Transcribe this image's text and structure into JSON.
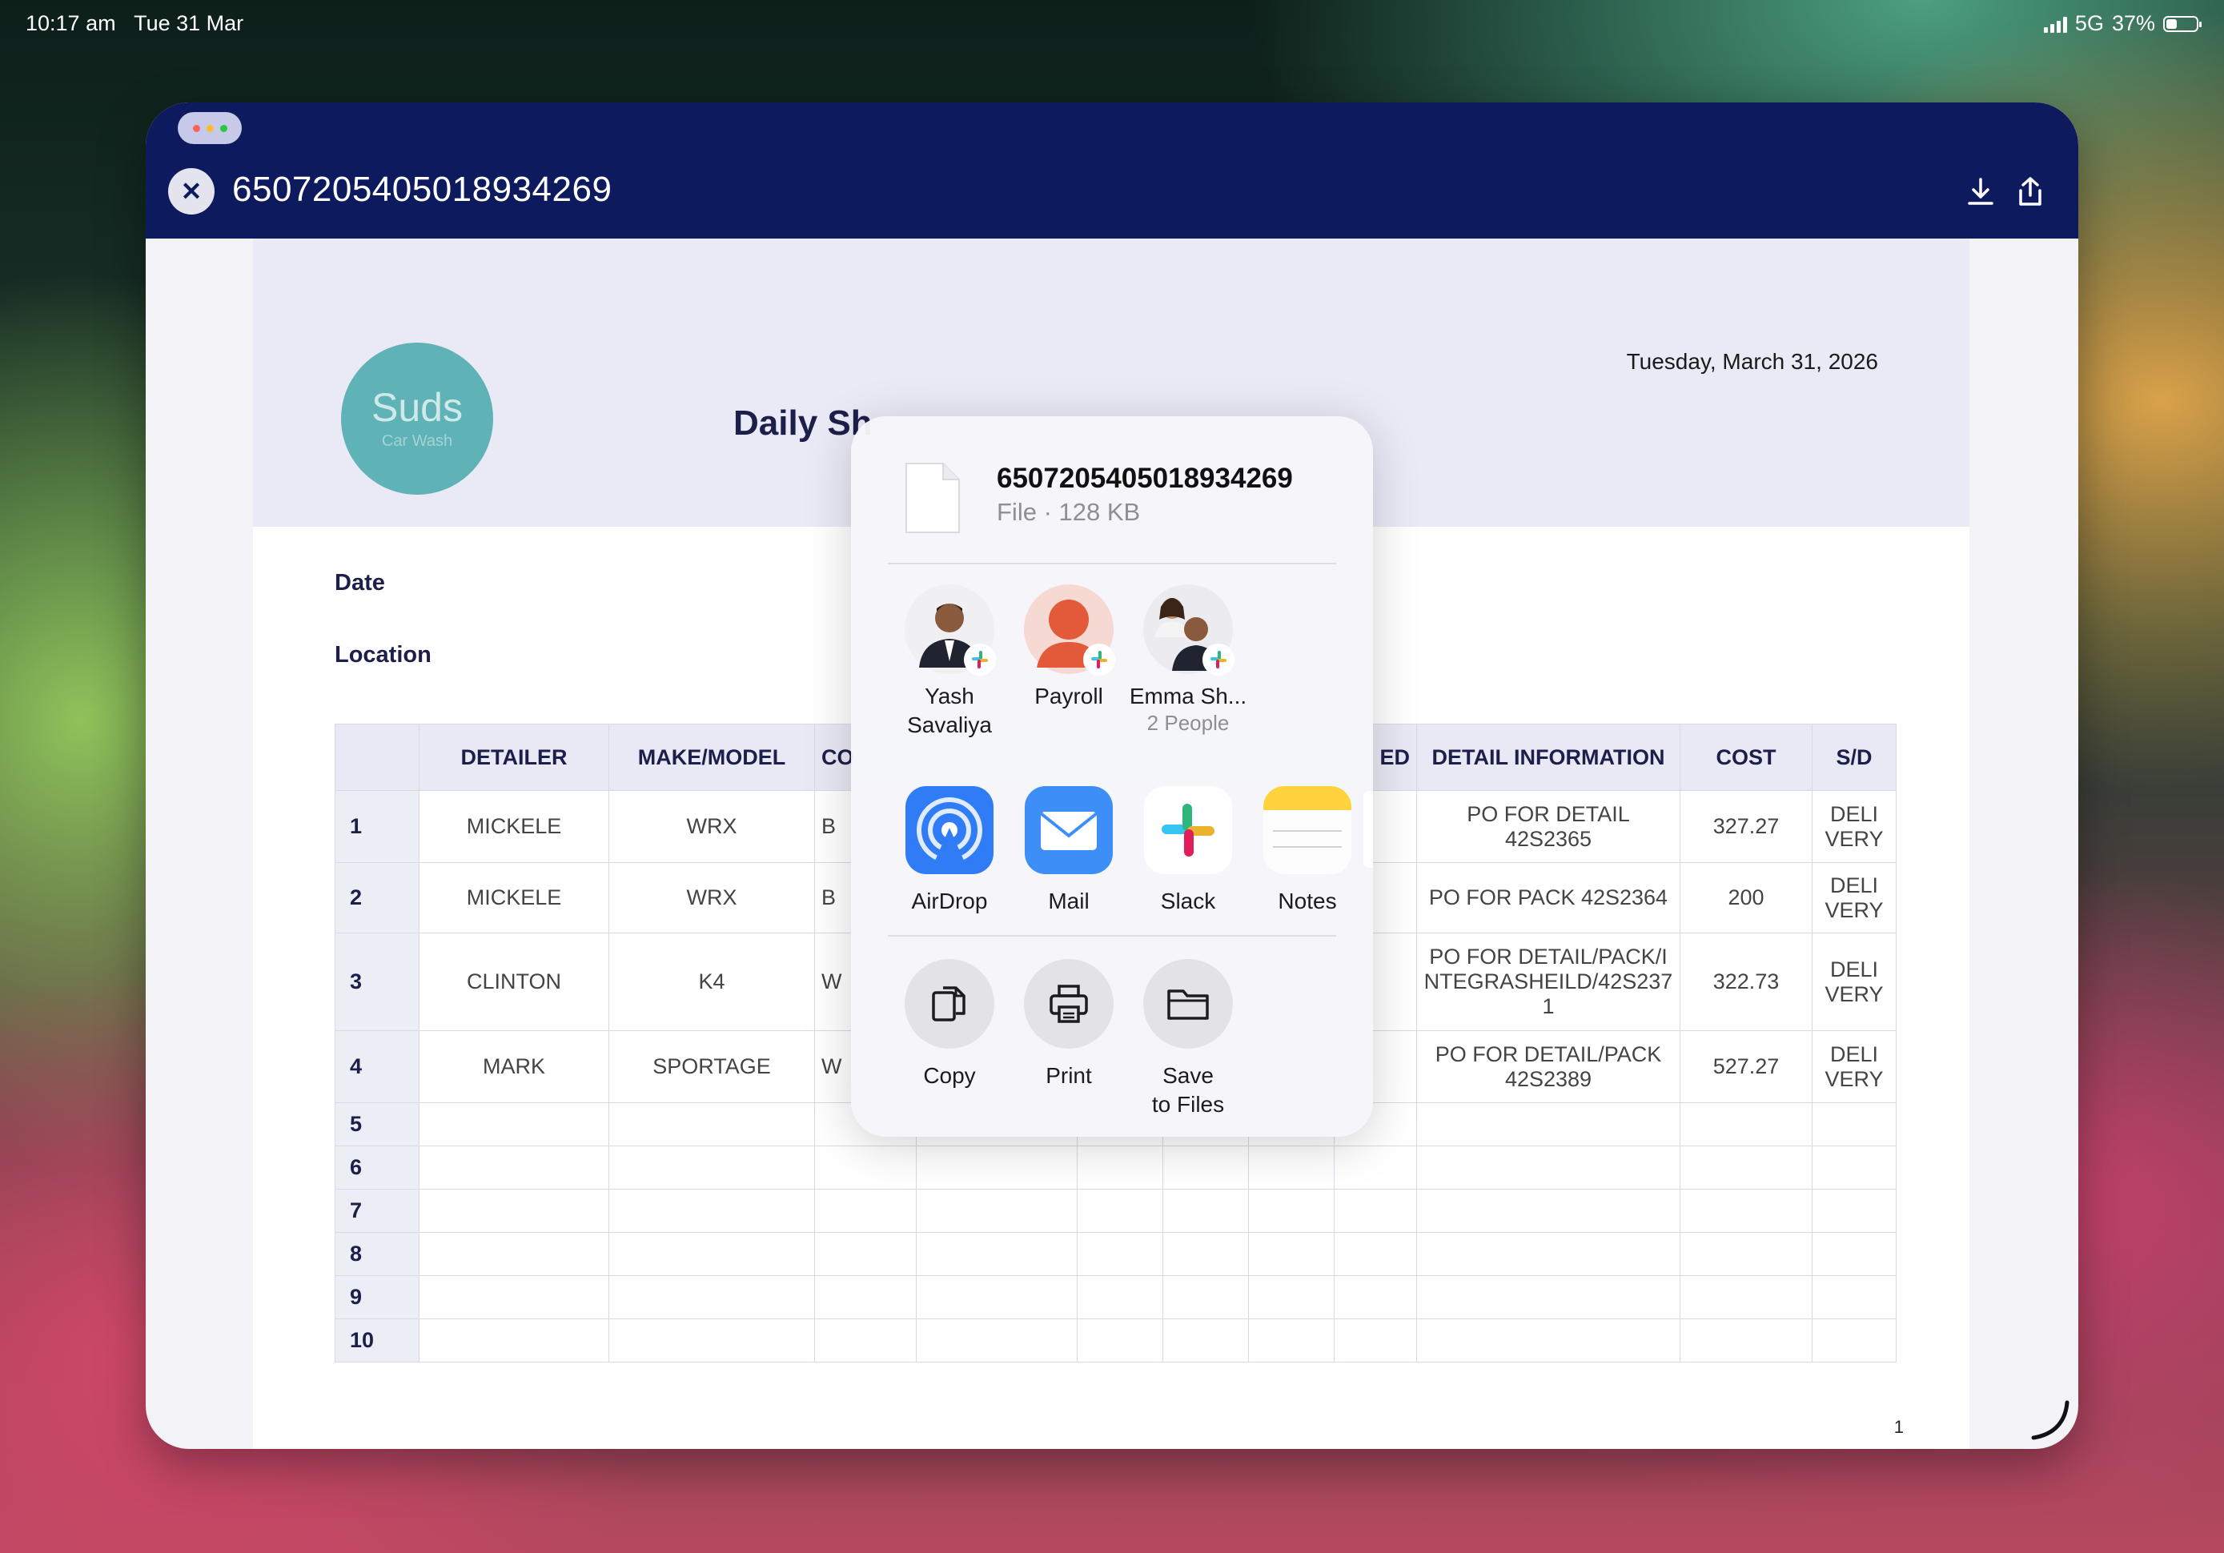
{
  "status_bar": {
    "time": "10:17 am",
    "date": "Tue 31 Mar",
    "network": "5G",
    "battery": "37%",
    "battery_level": 0.37
  },
  "window": {
    "title": "6507205405018934269",
    "close_icon": "close-icon",
    "download_icon": "download-icon",
    "share_icon": "share-icon"
  },
  "document": {
    "logo_text": "Suds",
    "logo_subtext": "Car Wash",
    "title": "Daily Sh",
    "date": "Tuesday, March 31, 2026",
    "labels": {
      "date": "Date",
      "location": "Location"
    },
    "page_number": "1",
    "table": {
      "headers": [
        "",
        "DETAILER",
        "MAKE/MODEL",
        "CO",
        "",
        "",
        "",
        "",
        "ED",
        "DETAIL INFORMATION",
        "COST",
        "S/D"
      ],
      "rows": [
        {
          "num": "1",
          "detailer": "MICKELE",
          "make": "WRX",
          "co": "B",
          "info": "PO FOR DETAIL 42S2365",
          "cost": "327.27",
          "sd": "DELI VERY"
        },
        {
          "num": "2",
          "detailer": "MICKELE",
          "make": "WRX",
          "co": "B",
          "info": "PO FOR PACK 42S2364",
          "cost": "200",
          "sd": "DELI VERY"
        },
        {
          "num": "3",
          "detailer": "CLINTON",
          "make": "K4",
          "co": "W",
          "info": "PO FOR DETAIL/PACK/INTEGRASHEILD/42S2371",
          "cost": "322.73",
          "sd": "DELI VERY"
        },
        {
          "num": "4",
          "detailer": "MARK",
          "make": "SPORTAGE",
          "co": "W",
          "info": "PO FOR DETAIL/PACK 42S2389",
          "cost": "527.27",
          "sd": "DELI VERY"
        },
        {
          "num": "5"
        },
        {
          "num": "6"
        },
        {
          "num": "7"
        },
        {
          "num": "8"
        },
        {
          "num": "9"
        },
        {
          "num": "10"
        }
      ]
    }
  },
  "share_sheet": {
    "file_name": "6507205405018934269",
    "file_meta": "File · 128 KB",
    "people": [
      {
        "name_line1": "Yash",
        "name_line2": "Savaliya"
      },
      {
        "name_line1": "Payroll"
      },
      {
        "name_line1": "Emma Sh...",
        "sub": "2 People"
      }
    ],
    "apps": [
      {
        "label": "AirDrop",
        "color": "#2f7cf6"
      },
      {
        "label": "Mail",
        "color": "#3d8ef7"
      },
      {
        "label": "Slack"
      },
      {
        "label": "Notes",
        "color": "#ffd33d"
      }
    ],
    "actions": [
      {
        "label": "Copy"
      },
      {
        "label": "Print"
      },
      {
        "label_line1": "Save",
        "label_line2": "to Files"
      }
    ]
  }
}
